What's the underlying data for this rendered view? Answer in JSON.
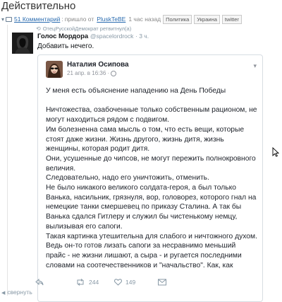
{
  "post": {
    "title": "Действительно",
    "comments": "51 Комментарий",
    "posted": "пришло от",
    "author": "PluskTeBE",
    "ago": "1 час назад",
    "tags": [
      "Политика",
      "Украина",
      "twitter"
    ]
  },
  "tweet": {
    "retweet_by": "ОтецРусскойДемократ ретвитнул(а)",
    "name": "Голос Мордора",
    "handle": "@spacelordrock",
    "time": "· 3 ч.",
    "text": "Добавить нечего."
  },
  "quoted": {
    "name": "Наталия Осипова",
    "date": "21 апр. в 16:36 ·",
    "lead": "У меня есть объяснение нападению на День Победы",
    "paragraphs": [
      "Ничтожества, озабоченные только собственным рационом, не могут находиться рядом с подвигом.",
      "Им болезненна сама мысль о том, что есть вещи, которые стоят даже жизни. Жизнь другого, жизнь дитя, жизнь женщины, которая родит дитя.",
      "Они, усушенные до чипсов, не могут пережить полнокровного величия.",
      "Следовательно, надо его уничтожить, отменить.",
      "Не было никакого великого солдата-героя, а был только Ванька, насильник, грязнуля, вор, головорез, которого гнал на немецкие танки смершевец по приказу Сталина. А так бы Ванька сдался Гитлеру и служил бы чистенькому немцу, вылизывая его сапоги.",
      "Такая картинка утешительна для слабого и ничтожного духом.",
      "Ведь он-то готов лизать сапоги за несравнимо меньший прайс - не жизни лишают, а сыра - и ругается последними словами на соотечественников и \"начальство\". Как, как"
    ]
  },
  "actions": {
    "collapse": "свернуть",
    "retweets": "244",
    "likes": "149"
  },
  "colors": {
    "link": "#2b6cb0",
    "muted": "#8899a6"
  }
}
